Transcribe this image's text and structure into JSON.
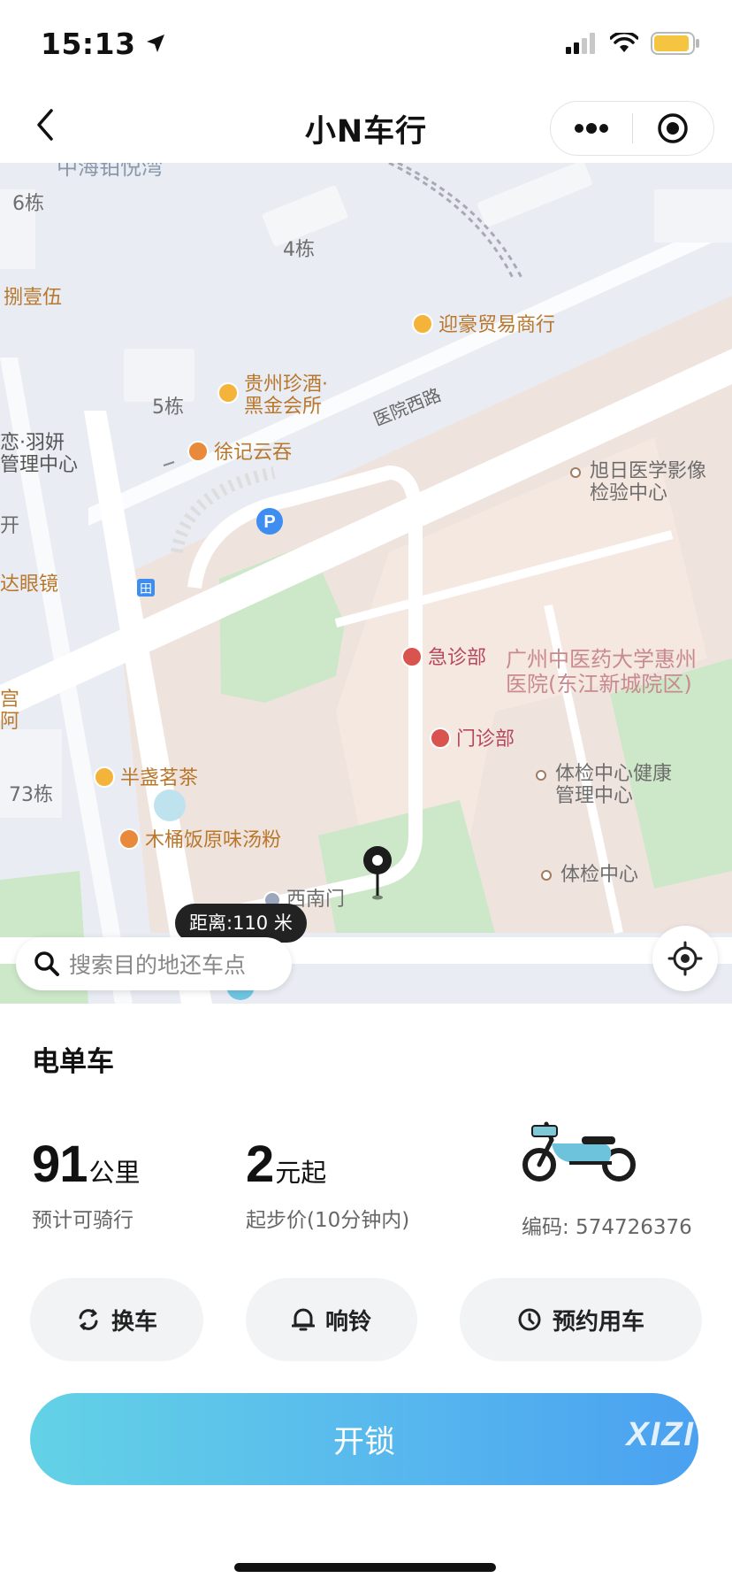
{
  "status_bar": {
    "time": "15:13",
    "icons": [
      "location-arrow-icon",
      "cellular-signal-icon",
      "wifi-icon",
      "battery-icon"
    ],
    "battery_color": "#f5c542"
  },
  "nav": {
    "back_icon": "chevron-left-icon",
    "title": "小N车行",
    "menu_icon": "more-dots-icon",
    "close_icon": "target-circle-icon"
  },
  "map": {
    "poi_labels": {
      "zhonghai": "中海铂悦湾",
      "b6": "6栋",
      "b4": "4栋",
      "b5": "5栋",
      "b73": "73栋",
      "bayiwu": "捌壹伍",
      "yinghao": "迎豪贸易商行",
      "guizhou": "贵州珍酒·\n黑金会所",
      "xuji": "徐记云吞",
      "yuyan": "恋·羽妍\n管理中心",
      "kai": "开",
      "dayanjing": "达眼镜",
      "xuri": "旭日医学影像\n检验中心",
      "jizhen": "急诊部",
      "hospital": "广州中医药大学惠州\n医院(东江新城院区)",
      "menzhen": "门诊部",
      "tijian_jk": "体检中心健康\n管理中心",
      "banzhan": "半盏茗茶",
      "mutong": "木桶饭原味汤粉",
      "tijian": "体检中心",
      "xinanmen": "西南门",
      "gong": "宫\n阿"
    },
    "road_label": "医院西路",
    "distance_label": "距离:110 米",
    "search_placeholder": "搜索目的地还车点",
    "colors": {
      "water": "#e6ecf4",
      "hospital_area": "#f1e5e0",
      "green": "#cfeacb",
      "road": "#ffffff"
    }
  },
  "panel": {
    "bike_type": "电单车",
    "range": {
      "value": "91",
      "unit": "公里",
      "desc": "预计可骑行"
    },
    "price": {
      "value": "2",
      "unit": "元起",
      "desc": "起步价(10分钟内)"
    },
    "code_label": "编码: 574726376",
    "actions": [
      {
        "label": "换车",
        "icon": "swap-icon"
      },
      {
        "label": "响铃",
        "icon": "bell-icon"
      },
      {
        "label": "预约用车",
        "icon": "clock-icon"
      }
    ],
    "unlock_label": "开锁",
    "watermark": "XIZI",
    "accent_gradient": [
      "#63d2e6",
      "#4aa1f0"
    ]
  }
}
